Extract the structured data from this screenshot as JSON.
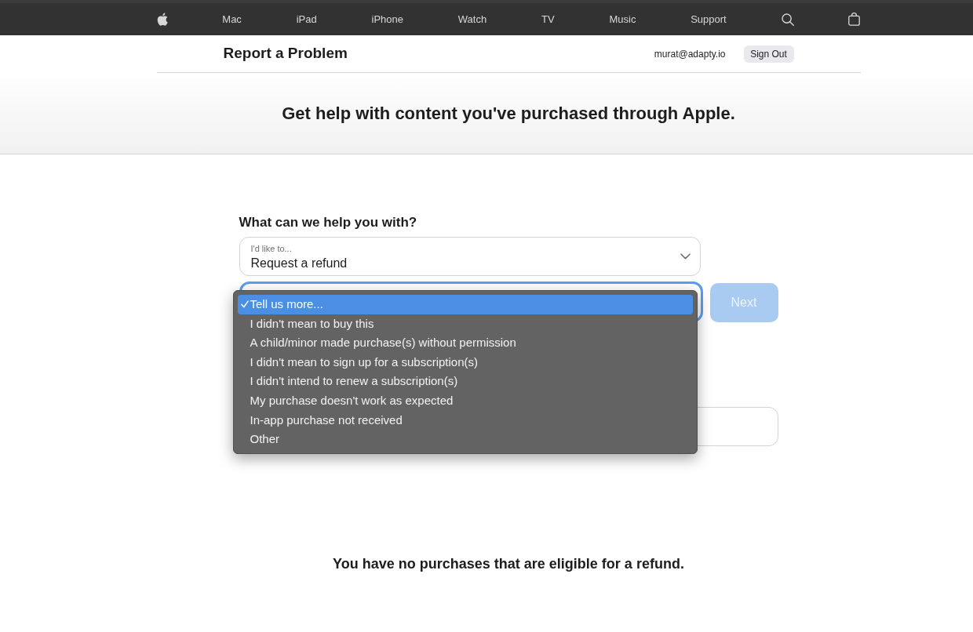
{
  "nav": {
    "links": [
      "Mac",
      "iPad",
      "iPhone",
      "Watch",
      "TV",
      "Music",
      "Support"
    ]
  },
  "header": {
    "title": "Report a Problem",
    "account": "murat@adapty.io",
    "sign_out_button": "Sign Out"
  },
  "hero": {
    "heading": "Get help with content you've purchased through Apple."
  },
  "form": {
    "question": "What can we help you with?",
    "request_select": {
      "label": "I'd like to...",
      "value": "Request a refund"
    },
    "reason_select": {
      "focused": true,
      "expanded": true,
      "options": [
        {
          "label": "Tell us more...",
          "selected": true
        },
        {
          "label": "I didn't mean to buy this",
          "selected": false
        },
        {
          "label": "A child/minor made purchase(s) without permission",
          "selected": false
        },
        {
          "label": "I didn't mean to sign up for a subscription(s)",
          "selected": false
        },
        {
          "label": "I didn't intend to renew a subscription(s)",
          "selected": false
        },
        {
          "label": "My purchase doesn't work as expected",
          "selected": false
        },
        {
          "label": "In-app purchase not received",
          "selected": false
        },
        {
          "label": "Other",
          "selected": false
        }
      ]
    },
    "next_button": {
      "label": "Next",
      "disabled": true
    }
  },
  "message": "You have no purchases that are eligible for a refund."
}
